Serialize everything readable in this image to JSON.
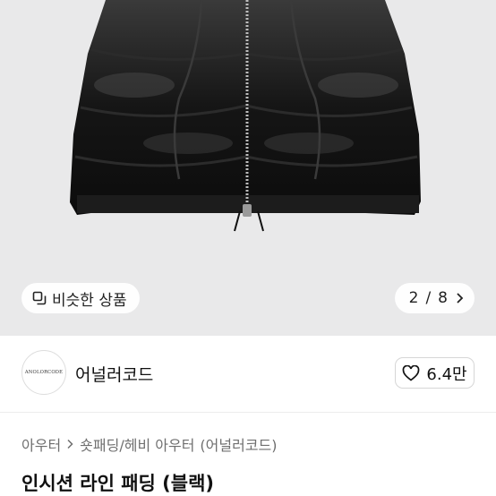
{
  "gallery": {
    "similar_label": "비슷한 상품",
    "current_page": "2",
    "page_separator": "/",
    "total_pages": "8"
  },
  "seller": {
    "avatar_text": "ANOLORCODE",
    "name": "어널러코드",
    "likes": "6.4만"
  },
  "breadcrumb": {
    "level1": "아우터",
    "level2": "숏패딩/헤비 아우터",
    "brand": "(어널러코드)"
  },
  "product": {
    "title": "인시션 라인 패딩 (블랙)"
  },
  "colors": {
    "hero_bg": "#e9e9ea",
    "jacket": "#141414"
  },
  "icons": {
    "similar": "copy-icon",
    "next": "chevron-right-icon",
    "like": "heart-outline-icon",
    "crumb_sep": "chevron-right-icon"
  }
}
